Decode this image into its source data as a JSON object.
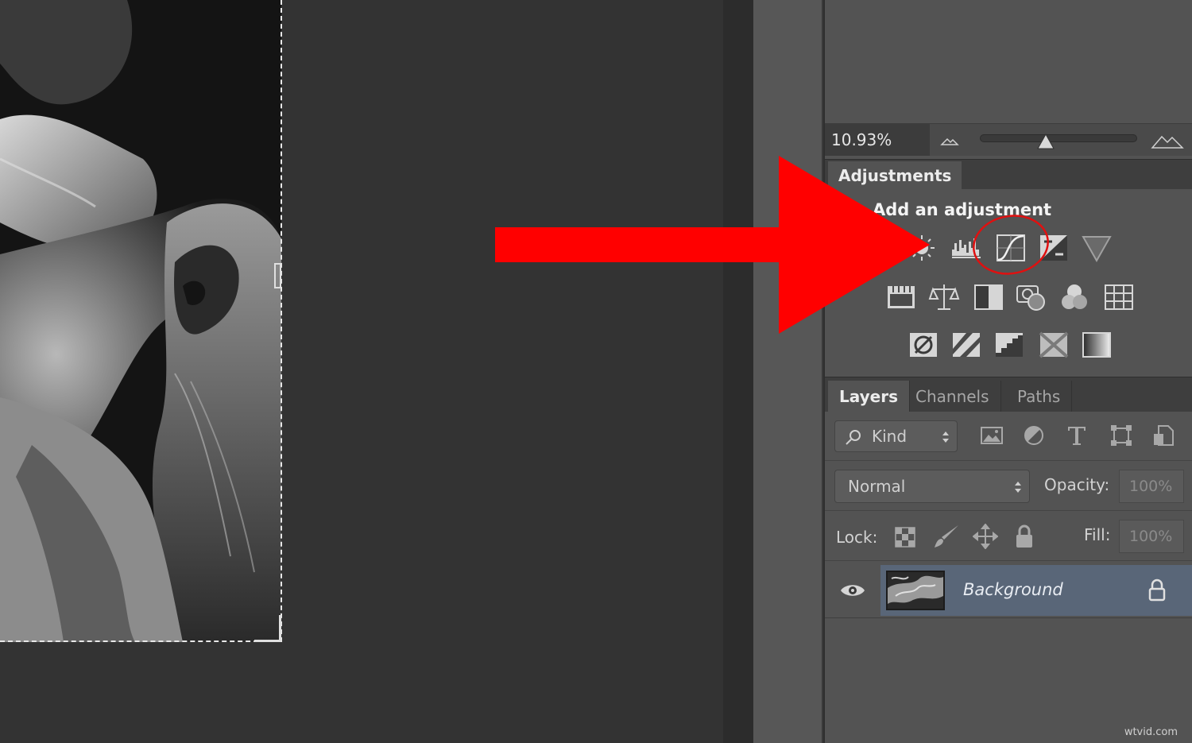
{
  "navigator": {
    "zoom_value": "10.93%",
    "zoom_level": 0.42
  },
  "adjustments": {
    "tab_label": "Adjustments",
    "subtitle": "Add an adjustment",
    "icons_row1": [
      "brightness-contrast-icon",
      "levels-icon",
      "curves-icon",
      "exposure-icon",
      "vibrance-icon"
    ],
    "icons_row2": [
      "hue-saturation-icon",
      "color-balance-icon",
      "black-white-icon",
      "photo-filter-icon",
      "channel-mixer-icon",
      "color-lookup-icon"
    ],
    "icons_row3": [
      "invert-icon",
      "posterize-icon",
      "threshold-icon",
      "selective-color-icon",
      "gradient-map-icon"
    ],
    "highlighted_icon": "curves-icon"
  },
  "layers_panel": {
    "tabs": [
      "Layers",
      "Channels",
      "Paths"
    ],
    "active_tab": "Layers",
    "filter_kind": "Kind",
    "blend_mode": "Normal",
    "opacity_label": "Opacity:",
    "opacity_value": "100%",
    "lock_label": "Lock:",
    "fill_label": "Fill:",
    "fill_value": "100%",
    "layers": [
      {
        "name": "Background",
        "visible": true,
        "locked": true
      }
    ]
  },
  "annotation": {
    "arrow_color": "#ff0000",
    "circle_color": "#e01010"
  },
  "watermark": "wtvid.com",
  "colors": {
    "panel_bg": "#535353",
    "canvas_bg": "#333333",
    "selected_layer": "#596678"
  }
}
